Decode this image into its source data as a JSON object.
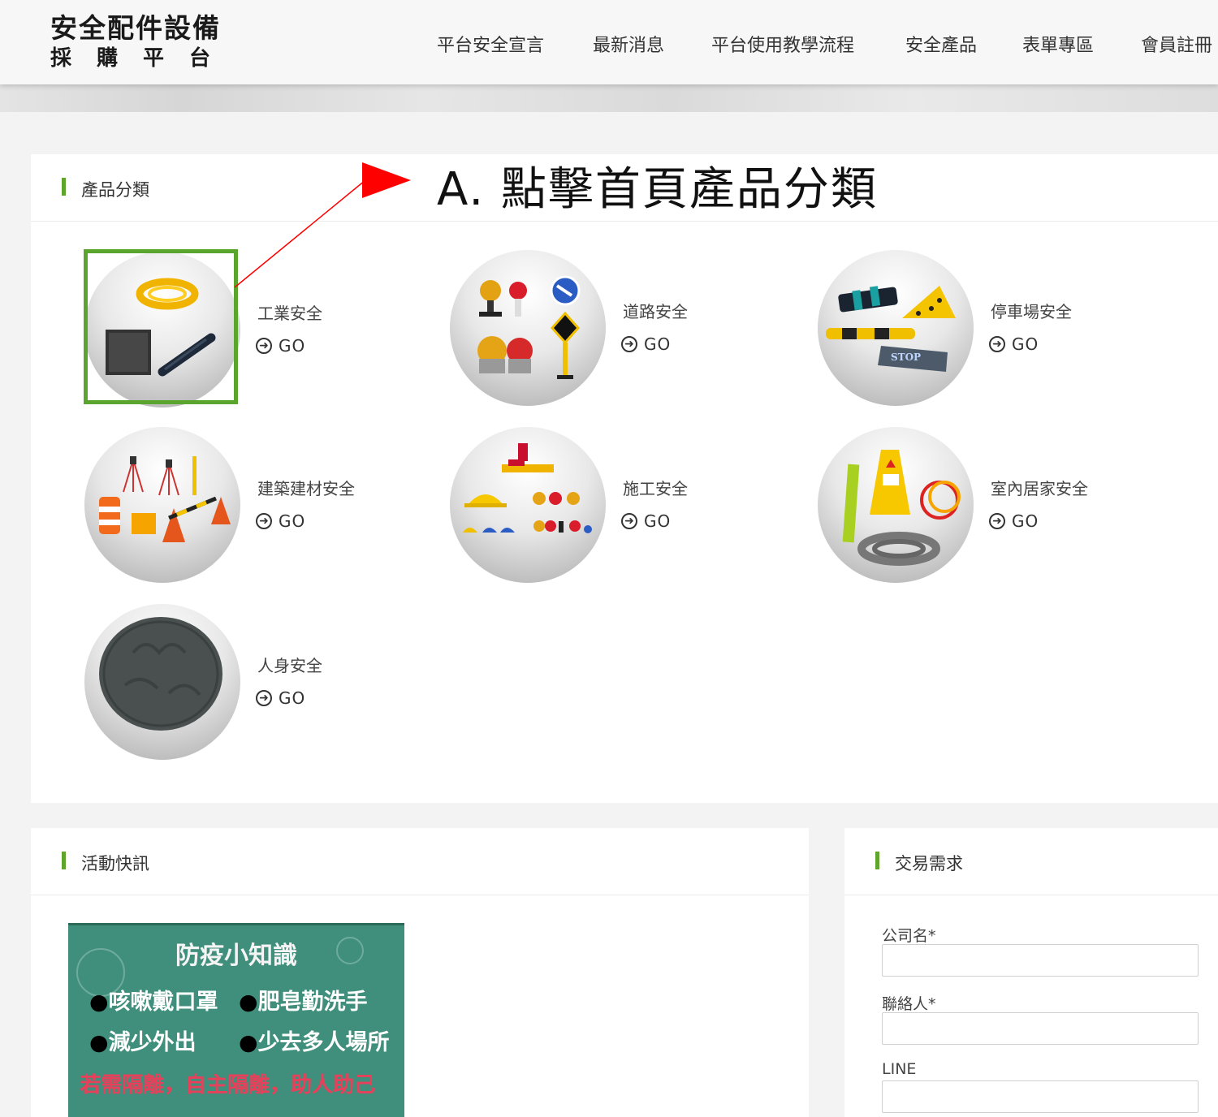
{
  "site": {
    "logo_line1": "安全配件設備",
    "logo_line2": "採購平台"
  },
  "nav": [
    {
      "label": "平台安全宣言"
    },
    {
      "label": "最新消息"
    },
    {
      "label": "平台使用教學流程"
    },
    {
      "label": "安全產品"
    },
    {
      "label": "表單專區"
    },
    {
      "label": "會員註冊"
    }
  ],
  "categories_panel": {
    "title": "產品分類",
    "go_label": "GO",
    "items": [
      {
        "name": "工業安全",
        "icon": "industrial-safety-products"
      },
      {
        "name": "道路安全",
        "icon": "road-safety-signs"
      },
      {
        "name": "停車場安全",
        "icon": "parking-safety-products"
      },
      {
        "name": "建築建材安全",
        "icon": "construction-barriers"
      },
      {
        "name": "施工安全",
        "icon": "worksite-helmets-lights"
      },
      {
        "name": "室內居家安全",
        "icon": "home-safety-products"
      },
      {
        "name": "人身安全",
        "icon": "rubber-mat"
      }
    ]
  },
  "annotation": {
    "text": "A. 點擊首頁產品分類",
    "color": "#ff0000",
    "box_color": "#5aa52e"
  },
  "news_panel": {
    "title": "活動快訊",
    "notice": {
      "title": "防疫小知識",
      "items": [
        "咳嗽戴口罩",
        "肥皂勤洗手",
        "減少外出",
        "少去多人場所"
      ],
      "slogan": "若需隔離，自主隔離，助人助己"
    }
  },
  "trade_panel": {
    "title": "交易需求",
    "fields": [
      {
        "label": "公司名*",
        "value": ""
      },
      {
        "label": "聯絡人*",
        "value": ""
      },
      {
        "label": "LINE",
        "value": ""
      }
    ]
  },
  "colors": {
    "accent_green": "#5fa52c",
    "notice_bg": "#3f8f7c"
  }
}
